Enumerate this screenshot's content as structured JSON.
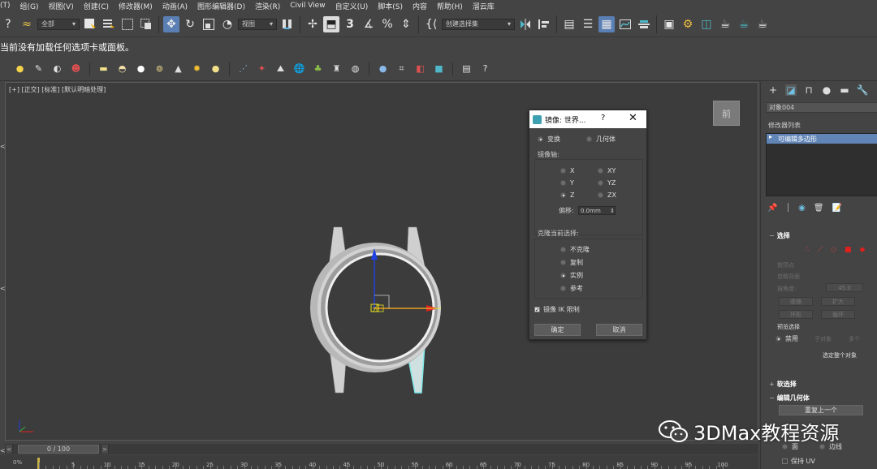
{
  "menu": [
    "(T)",
    "组(G)",
    "视图(V)",
    "创建(C)",
    "修改器(M)",
    "动画(A)",
    "图形编辑器(D)",
    "渲染(R)",
    "Civil View",
    "自定义(U)",
    "脚本(S)",
    "内容",
    "帮助(H)",
    "溜云库"
  ],
  "toolbar": {
    "selection_filter": "全部",
    "ref_coord": "视图",
    "named_selection": "创建选择集",
    "angle_snap_label": "3"
  },
  "prompt": "当前没有加载任何选项卡或面板。",
  "viewport": {
    "label": "[+] [正交] [标准] [默认明暗处理]",
    "viewcube": "前",
    "gizmo_label": "y"
  },
  "dialog": {
    "title": "镜像: 世界...",
    "help": "?",
    "close": "✕",
    "modes": [
      {
        "label": "变换",
        "selected": true
      },
      {
        "label": "几何体",
        "selected": false
      }
    ],
    "axis_group_label": "镜像轴:",
    "axes": [
      {
        "label": "X",
        "selected": false
      },
      {
        "label": "XY",
        "selected": false
      },
      {
        "label": "Y",
        "selected": false
      },
      {
        "label": "YZ",
        "selected": false
      },
      {
        "label": "Z",
        "selected": true
      },
      {
        "label": "ZX",
        "selected": false
      }
    ],
    "offset_label": "偏移:",
    "offset_value": "0.0mm",
    "clone_group_label": "克隆当前选择:",
    "clone_options": [
      {
        "label": "不克隆",
        "selected": false
      },
      {
        "label": "复制",
        "selected": false
      },
      {
        "label": "实例",
        "selected": true
      },
      {
        "label": "参考",
        "selected": false
      }
    ],
    "ik_label": "镜像 IK 限制",
    "ik_checked": true,
    "ok_label": "确定",
    "cancel_label": "取消"
  },
  "cmdpanel": {
    "object_name": "对象004",
    "modifier_list": "修改器列表",
    "stack_item": "可编辑多边形",
    "selection_rollout": "选择",
    "by_vertex": "按顶点",
    "ignore_backface": "忽略背面",
    "by_angle": "按角度:",
    "angle_value": "45.0",
    "shrink": "收缩",
    "grow": "扩大",
    "ring": "环形",
    "loop": "循环",
    "preview_selection": "预览选择",
    "preview_off": "禁用",
    "preview_subobj": "子对象",
    "preview_multi": "多个",
    "selected_status": "选定整个对象",
    "soft_selection": "软选择",
    "edit_geometry": "编辑几何体",
    "repeat_last": "重复上一个",
    "face": "面",
    "edge": "边线",
    "preserve_uv": "保持 UV"
  },
  "timeline": {
    "frame": "0 / 100",
    "ruler_start": "0%",
    "ticks": [
      "5",
      "10",
      "15",
      "20",
      "25",
      "30",
      "35",
      "40",
      "45",
      "50",
      "55",
      "60",
      "65",
      "70",
      "75",
      "80",
      "85",
      "90",
      "95",
      "100"
    ]
  },
  "watermark": "3DMax教程资源",
  "colors": {
    "accent": "#5a7fb4",
    "selection_blue": "#6285b7",
    "gizmo_red": "#e02020",
    "gizmo_blue": "#2040e0",
    "gizmo_yellow": "#e8e020",
    "watch_gray": "#c6c6c6",
    "selection_cyan": "#7fe8e8",
    "key_gold": "#c9b146"
  }
}
